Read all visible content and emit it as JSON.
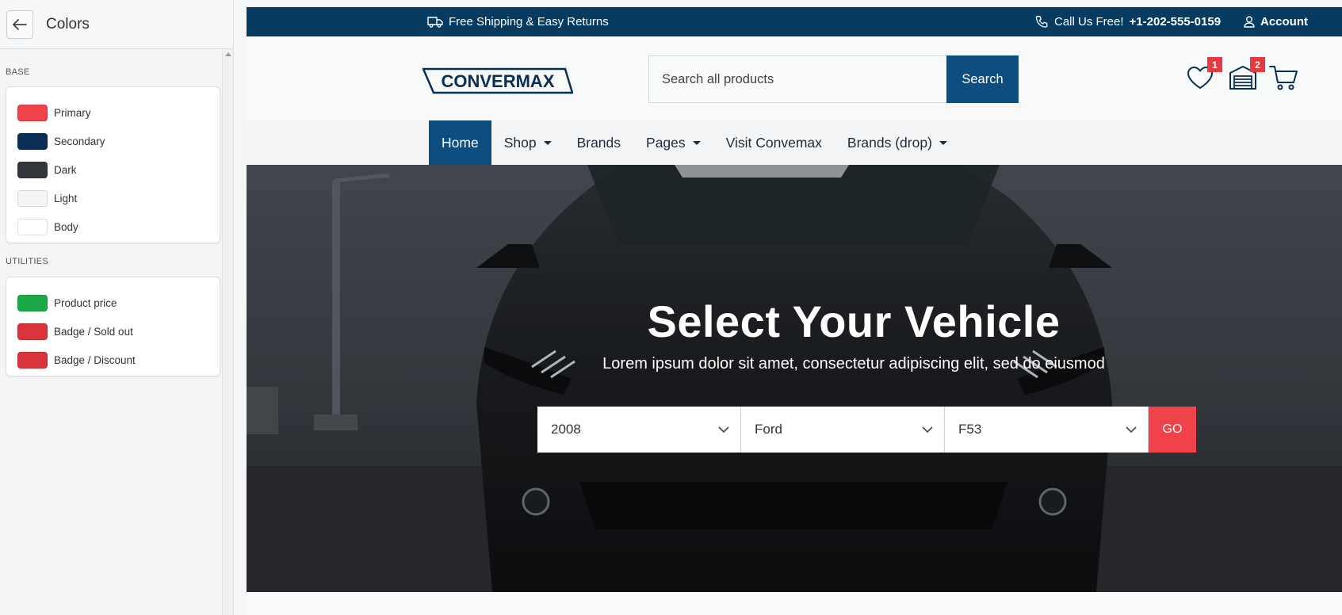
{
  "panel": {
    "title": "Colors",
    "sections": [
      {
        "label": "BASE",
        "items": [
          {
            "label": "Primary",
            "color": "#f0424a"
          },
          {
            "label": "Secondary",
            "color": "#0b2f54"
          },
          {
            "label": "Dark",
            "color": "#33363b"
          },
          {
            "label": "Light",
            "color": "#f4f5f6"
          },
          {
            "label": "Body",
            "color": "#ffffff"
          }
        ]
      },
      {
        "label": "UTILITIES",
        "items": [
          {
            "label": "Product price",
            "color": "#1fa84a"
          },
          {
            "label": "Badge / Sold out",
            "color": "#d9343b"
          },
          {
            "label": "Badge / Discount",
            "color": "#d9343b"
          }
        ]
      }
    ]
  },
  "store": {
    "topbar": {
      "shipping": "Free Shipping & Easy Returns",
      "call_prefix": "Call Us Free!",
      "phone": "+1-202-555-0159",
      "account": "Account"
    },
    "logo_text": "CONVERMAX",
    "search": {
      "placeholder": "Search all products",
      "button": "Search"
    },
    "wishlist_count": "1",
    "garage_count": "2",
    "nav": [
      {
        "label": "Home",
        "dropdown": false
      },
      {
        "label": "Shop",
        "dropdown": true
      },
      {
        "label": "Brands",
        "dropdown": false
      },
      {
        "label": "Pages",
        "dropdown": true
      },
      {
        "label": "Visit Convemax",
        "dropdown": false
      },
      {
        "label": "Brands (drop)",
        "dropdown": true
      }
    ],
    "hero": {
      "title": "Select Your Vehicle",
      "subtitle": "Lorem ipsum dolor sit amet, consectetur adipiscing elit, sed do eiusmod",
      "year": "2008",
      "make": "Ford",
      "model": "F53",
      "go": "GO"
    }
  },
  "colors": {
    "topbar": "#073b60",
    "accent": "#0d4d80",
    "primary": "#f0424a"
  }
}
